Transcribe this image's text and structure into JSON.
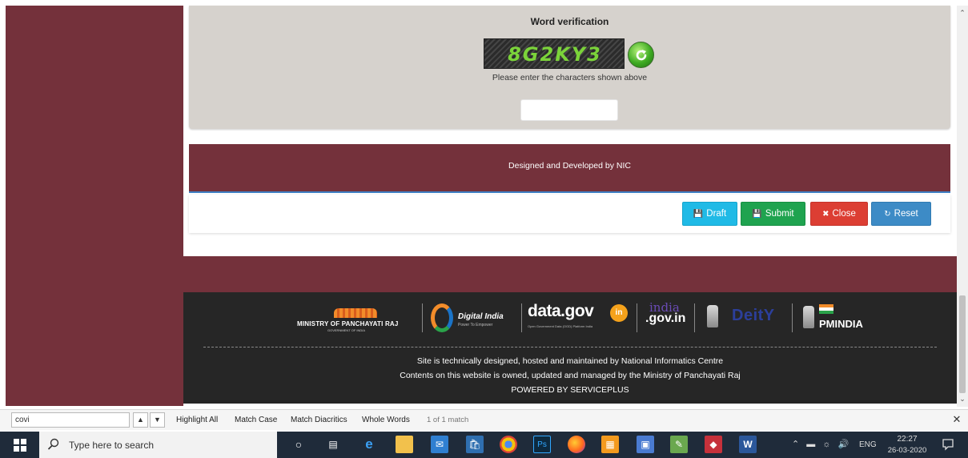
{
  "verification": {
    "title": "Word verification",
    "captcha_text": "8G2KY3",
    "help_text": "Please enter the characters shown above",
    "input_value": ""
  },
  "nic_bar": {
    "text": "Designed and Developed by NIC"
  },
  "actions": {
    "draft": "Draft",
    "submit": "Submit",
    "close": "Close",
    "reset": "Reset"
  },
  "footer": {
    "logos": {
      "mopr_name": "MINISTRY OF PANCHAYATI RAJ",
      "mopr_sub": "GOVERNMENT OF INDIA",
      "digital_india": "Digital India",
      "digital_india_tag": "Power To Empower",
      "datagov": "data.gov",
      "datagov_in": "in",
      "datagov_sub": "Open Government Data (OGD) Platform India",
      "indiagov_india": "india",
      "indiagov_gov": ".gov.in",
      "deity": "DeitY",
      "pmindia": "PMINDIA"
    },
    "line1": "Site is technically designed, hosted and maintained by National Informatics Centre",
    "line2": "Contents on this website is owned, updated and managed by the Ministry of Panchayati Raj",
    "line3": "POWERED BY SERVICEPLUS"
  },
  "findbar": {
    "query": "covi",
    "highlight_all": "Highlight All",
    "match_case": "Match Case",
    "match_diacritics": "Match Diacritics",
    "whole_words": "Whole Words",
    "status": "1 of 1 match"
  },
  "taskbar": {
    "search_placeholder": "Type here to search",
    "lang": "ENG",
    "time": "22:27",
    "date": "26-03-2020"
  },
  "colors": {
    "maroon": "#74313b",
    "panel": "#d6d2cd",
    "footer_dark": "#262626",
    "draft": "#20bae6",
    "submit": "#1fa34f",
    "close": "#dc3e33",
    "reset": "#3d8bc6",
    "taskbar": "#1f2b3a"
  }
}
